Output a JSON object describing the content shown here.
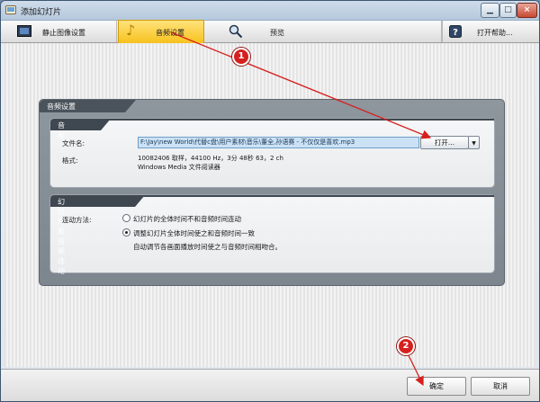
{
  "window": {
    "title": "添加幻灯片"
  },
  "toolbar": {
    "still_image": "静止图像设置",
    "audio": "音频设置",
    "preview": "预览",
    "help": "打开帮助..."
  },
  "panel": {
    "title": "音频设置",
    "audio_group": {
      "title": "音频",
      "filename_label": "文件名:",
      "filename_value": "F:\\Jay\\new World\\代替c盘\\用户素材\\音乐\\董全,孙语赛 - 不仅仅是喜欢.mp3",
      "open_button": "打开...",
      "format_label": "格式:",
      "format_line1": "10082406 取样，44100 Hz，3分 48秒 63，2 ch",
      "format_line2": "Windows Media 文件阅读器"
    },
    "sync_group": {
      "title": "幻灯片和音频连动",
      "method_label": "连动方法:",
      "option1": "幻灯片的全体时间不和音频时间连动",
      "option2": "调整幻灯片全体时间使之和音频时间一致",
      "option2_desc": "自动调节各画面播放时间使之与音频时间相吻合。",
      "selected": 2
    }
  },
  "footer": {
    "ok": "确定",
    "cancel": "取消"
  },
  "callouts": {
    "one": "1",
    "two": "2"
  },
  "colors": {
    "accent_tab": "#f7c21e",
    "callout": "#d6201e",
    "panel": "#7d858e"
  },
  "icons": {
    "still_image": "photo-frame-icon",
    "audio": "music-note-icon",
    "preview": "magnifier-icon",
    "help": "help-icon"
  }
}
